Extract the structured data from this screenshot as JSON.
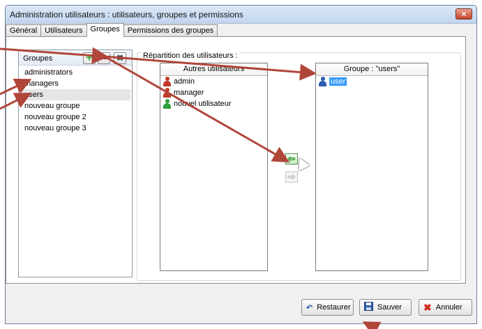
{
  "window": {
    "title": "Administration utilisateurs : utilisateurs, groupes et permissions",
    "close_label": "×"
  },
  "tabs": [
    {
      "label": "Général",
      "active": false
    },
    {
      "label": "Utilisateurs",
      "active": false
    },
    {
      "label": "Groupes",
      "active": true
    },
    {
      "label": "Permissions des groupes",
      "active": false
    }
  ],
  "groups_panel": {
    "label": "Groupes",
    "add_label": "+",
    "delete_label": "✖",
    "items": [
      "administrators",
      "managers",
      "users",
      "nouveau groupe",
      "nouveau groupe 2",
      "nouveau groupe 3"
    ],
    "selected_index": 2
  },
  "repartition": {
    "title": "Répartition des utilisateurs :",
    "others": {
      "header": "Autres utilisateurs",
      "users": [
        {
          "name": "admin",
          "icon": "user-red-icon",
          "color": "#c0392b"
        },
        {
          "name": "manager",
          "icon": "user-red-icon",
          "color": "#c0392b"
        },
        {
          "name": "nouvel utilisateur",
          "icon": "user-green-icon",
          "color": "#2e9e3a"
        }
      ]
    },
    "members": {
      "header": "Groupe : \"users\"",
      "users": [
        {
          "name": "user",
          "icon": "user-blue-icon",
          "color": "#2a5db0",
          "selected": true
        }
      ]
    },
    "move_left_label": "⇦",
    "move_right_label": "⇨"
  },
  "footer": {
    "restore_label": "Restaurer",
    "save_label": "Sauver",
    "cancel_label": "Annuler"
  },
  "colors": {
    "annotation_arrow": "#b0453a",
    "selection": "#3399ff",
    "title_gradient": "#c2d6ef"
  }
}
